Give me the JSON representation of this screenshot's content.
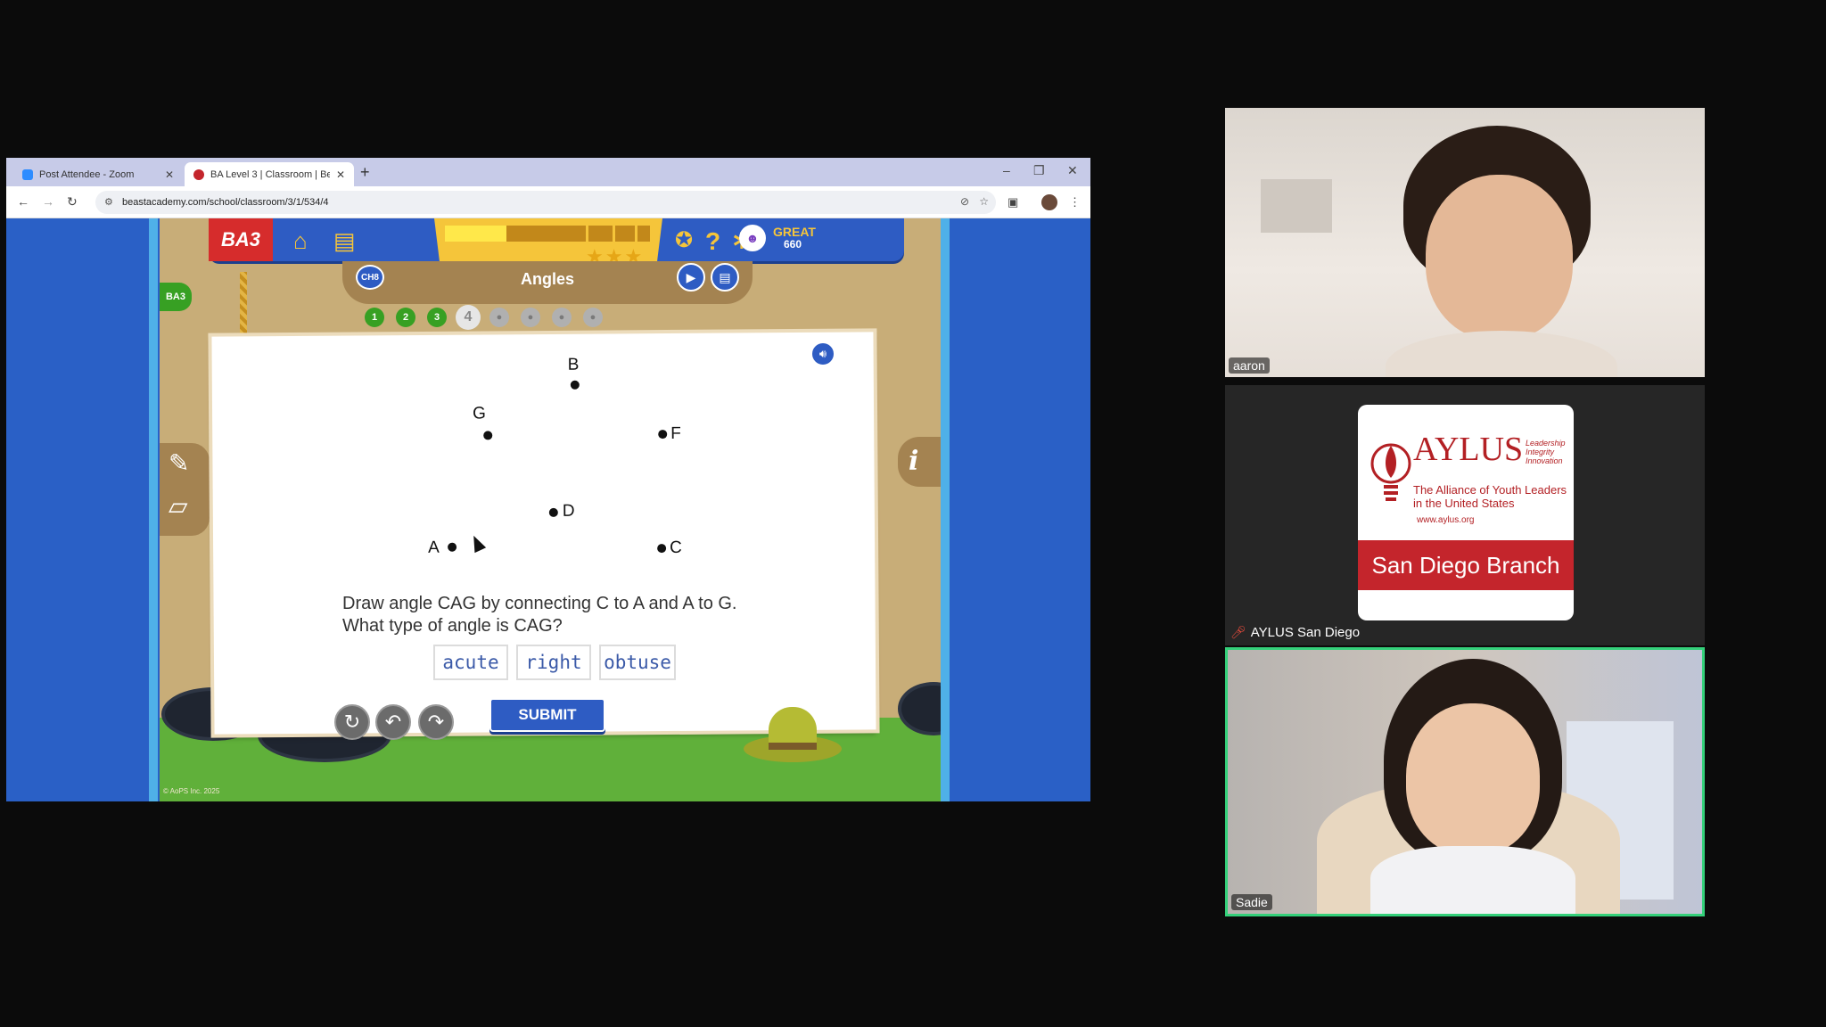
{
  "browser": {
    "tabs": [
      {
        "title": "Post Attendee - Zoom",
        "favicon_color": "#2d8cff"
      },
      {
        "title": "BA Level 3 | Classroom | Beast Academy",
        "favicon_color": "#c4252c"
      }
    ],
    "new_tab": "+",
    "url": "beastacademy.com/school/classroom/3/1/534/4"
  },
  "hud": {
    "logo": "BA3",
    "rating_label": "GREAT",
    "points": "660",
    "progress_fraction": 0.3
  },
  "lesson": {
    "chapter_badge": "CH8",
    "side_badge": "BA3",
    "title": "Angles",
    "levels": [
      "1",
      "2",
      "3",
      "4",
      "",
      "",
      "",
      ""
    ],
    "current_level": 4
  },
  "problem": {
    "points": [
      {
        "label": "B"
      },
      {
        "label": "G"
      },
      {
        "label": "F"
      },
      {
        "label": "D"
      },
      {
        "label": "A"
      },
      {
        "label": "C"
      }
    ],
    "question_line1": "Draw angle CAG by connecting C to A and A to G.",
    "question_line2": "What type of angle is CAG?",
    "choices": [
      "acute",
      "right",
      "obtuse"
    ],
    "submit_label": "SUBMIT"
  },
  "footer": {
    "copyright": "© AoPS Inc. 2025"
  },
  "participants": [
    {
      "name": "aaron"
    },
    {
      "name": "AYLUS San Diego"
    },
    {
      "name": "Sadie"
    }
  ],
  "aylus_card": {
    "title": "AYLUS",
    "tagline": "Leadership Integrity Innovation",
    "subtitle": "The Alliance of Youth Leaders in the United States",
    "url": "www.aylus.org",
    "branch": "San Diego Branch"
  },
  "colors": {
    "brand_blue": "#2e5cc3",
    "logo_red": "#d62c2c",
    "gold": "#f5c53a",
    "active_speaker": "#34d07a"
  }
}
